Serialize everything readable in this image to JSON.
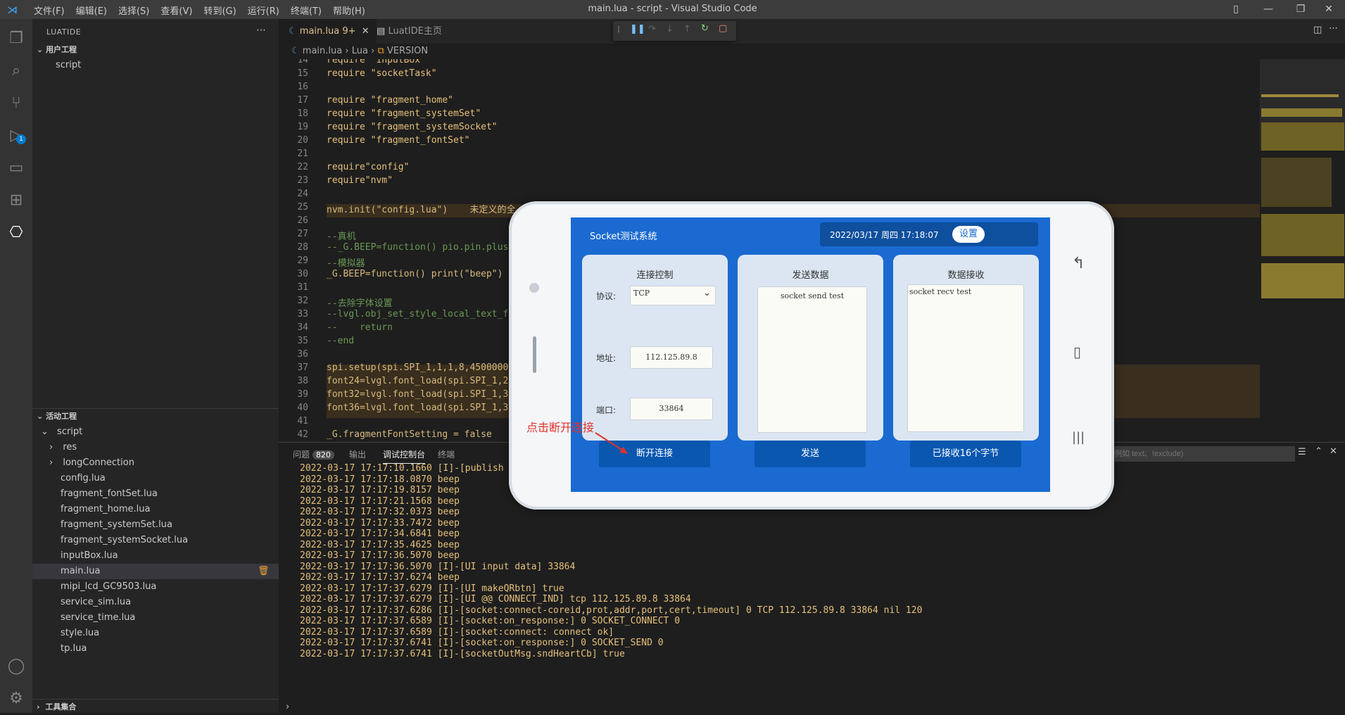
{
  "window": {
    "title": "main.lua - script - Visual Studio Code",
    "menu": [
      "文件(F)",
      "编辑(E)",
      "选择(S)",
      "查看(V)",
      "转到(G)",
      "运行(R)",
      "终端(T)",
      "帮助(H)"
    ]
  },
  "activity": {
    "run_badge": "1"
  },
  "sidebar": {
    "title": "LUATIDE",
    "user_project_header": "用户工程",
    "user_project_item": "script",
    "active_project_header": "活动工程",
    "active_root": "script",
    "folders": [
      "res",
      "longConnection"
    ],
    "files": [
      "config.lua",
      "fragment_fontSet.lua",
      "fragment_home.lua",
      "fragment_systemSet.lua",
      "fragment_systemSocket.lua",
      "inputBox.lua",
      "main.lua",
      "mipi_lcd_GC9503.lua",
      "service_sim.lua",
      "service_time.lua",
      "style.lua",
      "tp.lua"
    ],
    "tools_header": "工具集合"
  },
  "tabs": [
    {
      "label": "main.lua",
      "suffix": "9+"
    },
    {
      "label": "LuatIDE主页"
    }
  ],
  "breadcrumb": {
    "file": "main.lua",
    "lang": "Lua",
    "symbol": "VERSION"
  },
  "code": [
    {
      "n": "14",
      "t": "require \"inputBox\""
    },
    {
      "n": "15",
      "t": "require \"socketTask\""
    },
    {
      "n": "16",
      "t": ""
    },
    {
      "n": "17",
      "t": "require \"fragment_home\""
    },
    {
      "n": "18",
      "t": "require \"fragment_systemSet\""
    },
    {
      "n": "19",
      "t": "require \"fragment_systemSocket\""
    },
    {
      "n": "20",
      "t": "require \"fragment_fontSet\""
    },
    {
      "n": "21",
      "t": ""
    },
    {
      "n": "22",
      "t": "require\"config\""
    },
    {
      "n": "23",
      "t": "require\"nvm\""
    },
    {
      "n": "24",
      "t": ""
    },
    {
      "n": "25",
      "t": "nvm.init(\"config.lua\")    未定义的全"
    },
    {
      "n": "26",
      "t": ""
    },
    {
      "n": "27",
      "t": "--真机"
    },
    {
      "n": "28",
      "t": "--_G.BEEP=function() pio.pin.plus("
    },
    {
      "n": "29",
      "t": "--模拟器"
    },
    {
      "n": "30",
      "t": "_G.BEEP=function() print(\"beep\") e"
    },
    {
      "n": "31",
      "t": ""
    },
    {
      "n": "32",
      "t": "--去除字体设置"
    },
    {
      "n": "33",
      "t": "--lvgl.obj_set_style_local_text_fo"
    },
    {
      "n": "34",
      "t": "--    return"
    },
    {
      "n": "35",
      "t": "--end"
    },
    {
      "n": "36",
      "t": ""
    },
    {
      "n": "37",
      "t": "spi.setup(spi.SPI_1,1,1,8,45000000"
    },
    {
      "n": "38",
      "t": "font24=lvgl.font_load(spi.SPI_1,24"
    },
    {
      "n": "39",
      "t": "font32=lvgl.font_load(spi.SPI_1,32"
    },
    {
      "n": "40",
      "t": "font36=lvgl.font_load(spi.SPI_1,36"
    },
    {
      "n": "41",
      "t": ""
    },
    {
      "n": "42",
      "t": "_G.fragmentFontSetting = false"
    }
  ],
  "panel": {
    "tabs": [
      "问题",
      "输出",
      "调试控制台",
      "终端"
    ],
    "problems_count": "820",
    "filter_placeholder": "例如 text、!exclude)",
    "logs": [
      "2022-03-17 17:17:10.1660 [I]-[publish ...",
      "2022-03-17 17:17:18.0870 beep",
      "2022-03-17 17:17:19.8157 beep",
      "2022-03-17 17:17:21.1568 beep",
      "2022-03-17 17:17:32.0373 beep",
      "2022-03-17 17:17:33.7472 beep",
      "2022-03-17 17:17:34.6841 beep",
      "2022-03-17 17:17:35.4625 beep",
      "2022-03-17 17:17:36.5070 beep",
      "2022-03-17 17:17:36.5070 [I]-[UI input data] 33864",
      "2022-03-17 17:17:37.6274 beep",
      "2022-03-17 17:17:37.6279 [I]-[UI makeQRbtn] true",
      "2022-03-17 17:17:37.6279 [I]-[UI @@ CONNECT_IND] tcp 112.125.89.8 33864",
      "2022-03-17 17:17:37.6286 [I]-[socket:connect-coreid,prot,addr,port,cert,timeout] 0 TCP 112.125.89.8 33864 nil 120",
      "2022-03-17 17:17:37.6589 [I]-[socket:on_response:] 0 SOCKET_CONNECT 0",
      "2022-03-17 17:17:37.6589 [I]-[socket:connect: connect ok]",
      "2022-03-17 17:17:37.6741 [I]-[socket:on_response:] 0 SOCKET_SEND 0",
      "2022-03-17 17:17:37.6741 [I]-[socketOutMsg.sndHeartCb] true"
    ]
  },
  "device": {
    "app_title": "Socket测试系统",
    "datetime": "2022/03/17 周四 17:18:07",
    "settings_button": "设置",
    "conn_card_title": "连接控制",
    "protocol_label": "协议:",
    "protocol_value": "TCP",
    "address_label": "地址:",
    "address_value": "112.125.89.8",
    "port_label": "端口:",
    "port_value": "33864",
    "disconnect_button": "断开连接",
    "send_card_title": "发送数据",
    "send_text": "socket send test",
    "send_button": "发送",
    "recv_card_title": "数据接收",
    "recv_text": "socket recv test",
    "recv_button": "已接收16个字节",
    "annotation": "点击断开连接"
  },
  "colors": {
    "accent": "#007acc",
    "device_blue": "#1a6ad1",
    "button_blue": "#0a57b0",
    "annotation_red": "#e0312b"
  }
}
